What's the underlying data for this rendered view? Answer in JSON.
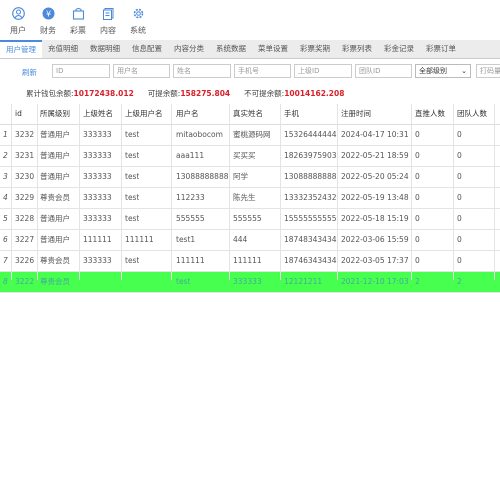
{
  "nav": [
    {
      "label": "用户",
      "icon": "user-icon"
    },
    {
      "label": "财务",
      "icon": "yen-icon"
    },
    {
      "label": "彩票",
      "icon": "shopping-bag-icon"
    },
    {
      "label": "内容",
      "icon": "document-icon"
    },
    {
      "label": "系统",
      "icon": "gear-icon"
    }
  ],
  "tabs": [
    "用户管理",
    "充值明细",
    "数据明细",
    "信息配置",
    "内容分类",
    "系统数据",
    "菜单设置",
    "彩票奖期",
    "彩票列表",
    "彩金记录",
    "彩票订单"
  ],
  "filter": {
    "refresh": "刷新",
    "placeholders": [
      "ID",
      "用户名",
      "姓名",
      "手机号",
      "上级ID",
      "团队ID"
    ],
    "level_select": "全部级别",
    "last_placeholder": "打码量"
  },
  "summary": {
    "wallet_label": "累计钱包余额:",
    "wallet_value": "10172438.012",
    "withdrawable_label": "可提余额:",
    "withdrawable_value": "158275.804",
    "not_withdrawable_label": "不可提余额:",
    "not_withdrawable_value": "10014162.208"
  },
  "table": {
    "headers": [
      "id",
      "所属级别",
      "上级姓名",
      "上级用户名",
      "用户名",
      "真实姓名",
      "手机",
      "注册时间",
      "直推人数",
      "团队人数"
    ],
    "rows": [
      [
        "1",
        "3232",
        "普通用户",
        "333333",
        "test",
        "mitaobocom",
        "蜜桃源码网",
        "15326444444",
        "2024-04-17 10:31",
        "0",
        "0"
      ],
      [
        "2",
        "3231",
        "普通用户",
        "333333",
        "test",
        "aaa111",
        "买买买",
        "18263975903",
        "2022-05-21 18:59",
        "0",
        "0"
      ],
      [
        "3",
        "3230",
        "普通用户",
        "333333",
        "test",
        "13088888888",
        "阿学",
        "13088888888",
        "2022-05-20 05:24",
        "0",
        "0"
      ],
      [
        "4",
        "3229",
        "尊贵会员",
        "333333",
        "test",
        "112233",
        "陈先生",
        "13332352432",
        "2022-05-19 13:48",
        "0",
        "0"
      ],
      [
        "5",
        "3228",
        "普通用户",
        "333333",
        "test",
        "555555",
        "555555",
        "15555555555",
        "2022-05-18 15:19",
        "0",
        "0"
      ],
      [
        "6",
        "3227",
        "普通用户",
        "111111",
        "111111",
        "test1",
        "444",
        "18748343434",
        "2022-03-06 15:59",
        "0",
        "0"
      ],
      [
        "7",
        "3226",
        "尊贵会员",
        "333333",
        "test",
        "111111",
        "111111",
        "18746343434",
        "2022-03-05 17:37",
        "0",
        "0"
      ],
      [
        "8",
        "3222",
        "尊贵会员",
        "",
        "",
        "test",
        "333333",
        "12121211",
        "2021-12-10 17:03",
        "2",
        "2"
      ]
    ]
  }
}
